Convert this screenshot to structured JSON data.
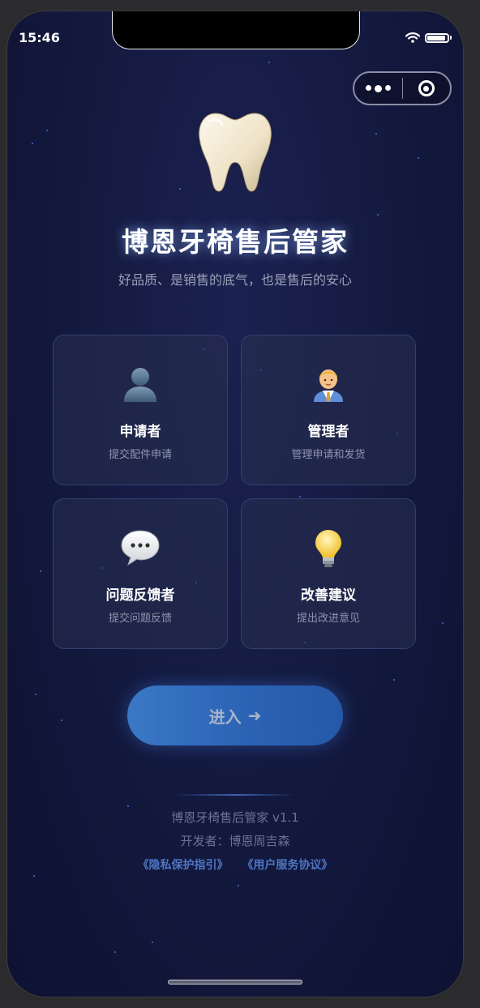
{
  "status": {
    "time": "15:46"
  },
  "app": {
    "title": "博恩牙椅售后管家",
    "subtitle": "好品质、是销售的底气，也是售后的安心"
  },
  "roles": [
    {
      "name": "申请者",
      "desc": "提交配件申请",
      "icon": "person-silhouette-icon"
    },
    {
      "name": "管理者",
      "desc": "管理申请和发货",
      "icon": "manager-icon"
    },
    {
      "name": "问题反馈者",
      "desc": "提交问题反馈",
      "icon": "speech-bubble-icon"
    },
    {
      "name": "改善建议",
      "desc": "提出改进意见",
      "icon": "lightbulb-icon"
    }
  ],
  "enter_button": {
    "label": "进入",
    "arrow": "➜"
  },
  "footer": {
    "version": "博恩牙椅售后管家 v1.1",
    "developer": "开发者：博恩周吉森",
    "privacy_link": "《隐私保护指引》",
    "terms_link": "《用户服务协议》"
  },
  "colors": {
    "background": "#141a40",
    "card_border": "#33406e",
    "button": "#3a78c6",
    "link": "#4e76c2"
  }
}
